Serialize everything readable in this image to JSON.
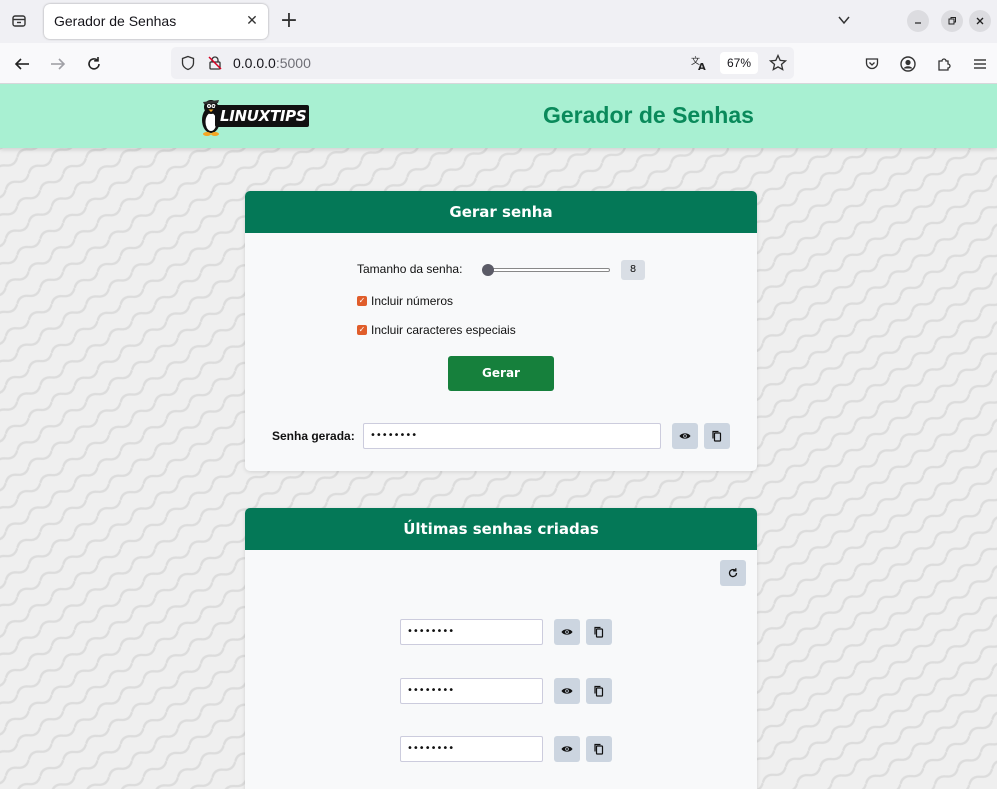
{
  "browser": {
    "tab_title": "Gerador de Senhas",
    "url_host": "0.0.0.0",
    "url_port": ":5000",
    "zoom": "67%"
  },
  "site": {
    "logo_text": "LINUXTIPS",
    "title": "Gerador de Senhas"
  },
  "generate_card": {
    "header": "Gerar senha",
    "length_label": "Tamanho da senha:",
    "length_value": "8",
    "include_numbers_label": "Incluir números",
    "include_numbers_checked": true,
    "include_special_label": "Incluir caracteres especiais",
    "include_special_checked": true,
    "generate_button": "Gerar",
    "generated_label": "Senha gerada:",
    "generated_value": "••••••••"
  },
  "history_card": {
    "header": "Últimas senhas criadas",
    "passwords": [
      "••••••••",
      "••••••••",
      "••••••••"
    ]
  },
  "colors": {
    "header_bg": "#a8f0d2",
    "card_header": "#047857",
    "title_green": "#0a8a5b",
    "button_green": "#16803c",
    "checkbox": "#e05d2a"
  }
}
